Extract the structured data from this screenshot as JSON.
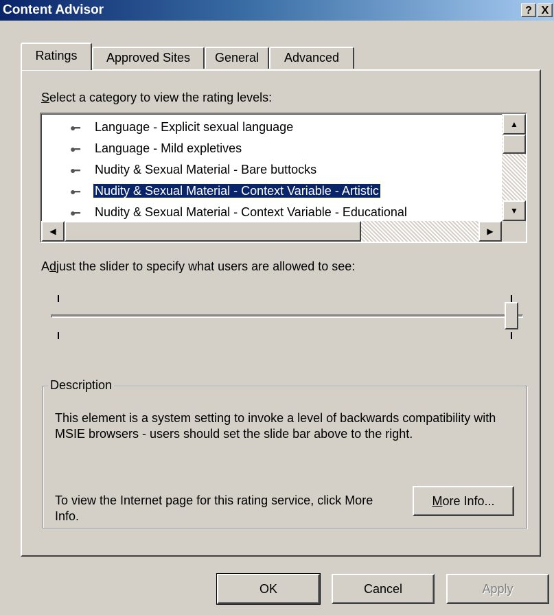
{
  "window": {
    "title": "Content Advisor",
    "help_glyph": "?",
    "close_glyph": "X"
  },
  "tabs": [
    "Ratings",
    "Approved Sites",
    "General",
    "Advanced"
  ],
  "active_tab": "Ratings",
  "category_label": {
    "accel": "S",
    "rest": "elect a category to view the rating levels:"
  },
  "categories": [
    {
      "label": "Language - Explicit sexual language",
      "selected": false
    },
    {
      "label": "Language - Mild expletives",
      "selected": false
    },
    {
      "label": "Nudity & Sexual Material - Bare buttocks",
      "selected": false
    },
    {
      "label": "Nudity & Sexual Material - Context Variable - Artistic",
      "selected": true
    },
    {
      "label": "Nudity & Sexual Material - Context Variable - Educational",
      "selected": false
    }
  ],
  "scroll_glyphs": {
    "up": "▲",
    "down": "▼",
    "left": "◀",
    "right": "▶"
  },
  "slider_label": {
    "pre": "A",
    "accel": "d",
    "rest": "just the slider to specify what users are allowed to see:"
  },
  "slider": {
    "level": 1.0
  },
  "description": {
    "legend": "Description",
    "text": "This element is a system setting to invoke a level of backwards compatibility with MSIE browsers - users should set the slide bar above to the right.",
    "more_info_text": "To view the Internet page for this rating service, click More Info.",
    "more_info_button": {
      "accel": "M",
      "rest": "ore Info..."
    }
  },
  "buttons": {
    "ok": "OK",
    "cancel": "Cancel",
    "apply": "Apply"
  },
  "colors": {
    "selection": "#0a246a",
    "face": "#d4d0c8",
    "title_start": "#0a246a",
    "title_end": "#a6caf0"
  }
}
